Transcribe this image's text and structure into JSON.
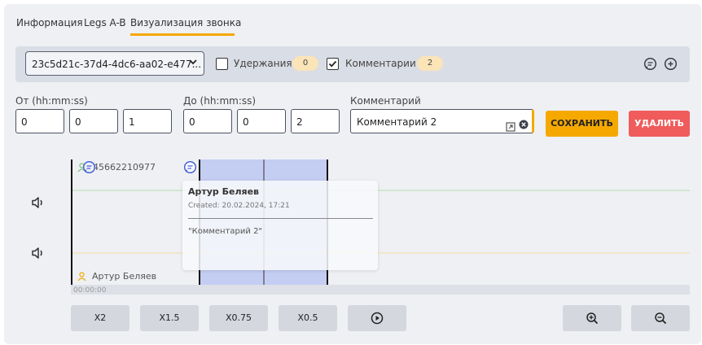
{
  "tabs": [
    {
      "label": "Информация"
    },
    {
      "label": "Legs A-B"
    },
    {
      "label": "Визуализация звонка"
    }
  ],
  "toolbar": {
    "call_id": "23c5d21c-37d4-4dc6-aa02-e477...",
    "holds_label": "Удержания",
    "holds_count": "0",
    "holds_checked": false,
    "comments_label": "Комментарии",
    "comments_count": "2",
    "comments_checked": true,
    "icons": [
      "comment-icon",
      "add-comment-icon"
    ]
  },
  "form": {
    "from_label": "От (hh:mm:ss)",
    "from": [
      "0",
      "0",
      "1"
    ],
    "to_label": "До (hh:mm:ss)",
    "to": [
      "0",
      "0",
      "2"
    ],
    "comment_label": "Комментарий",
    "comment_value": "Комментарий 2",
    "save_label": "СОХРАНИТЬ",
    "delete_label": "УДАЛИТЬ",
    "colors": {
      "save": "#f5a800",
      "delete": "#f05b5b",
      "accent": "#f5a800",
      "selection": "#c4cdf2"
    }
  },
  "timeline": {
    "caller": "45662210977",
    "callee": "Артур Беляев",
    "time_start": "00:00:00",
    "popup": {
      "author": "Артур Беляев",
      "created": "Created: 20.02.2024, 17:21",
      "text": "\"Комментарий 2\""
    }
  },
  "controls": {
    "speeds": [
      "X2",
      "X1.5",
      "X0.75",
      "X0.5"
    ],
    "play_icon": "play-icon",
    "zoom_in_icon": "zoom-in-icon",
    "zoom_out_icon": "zoom-out-icon"
  }
}
